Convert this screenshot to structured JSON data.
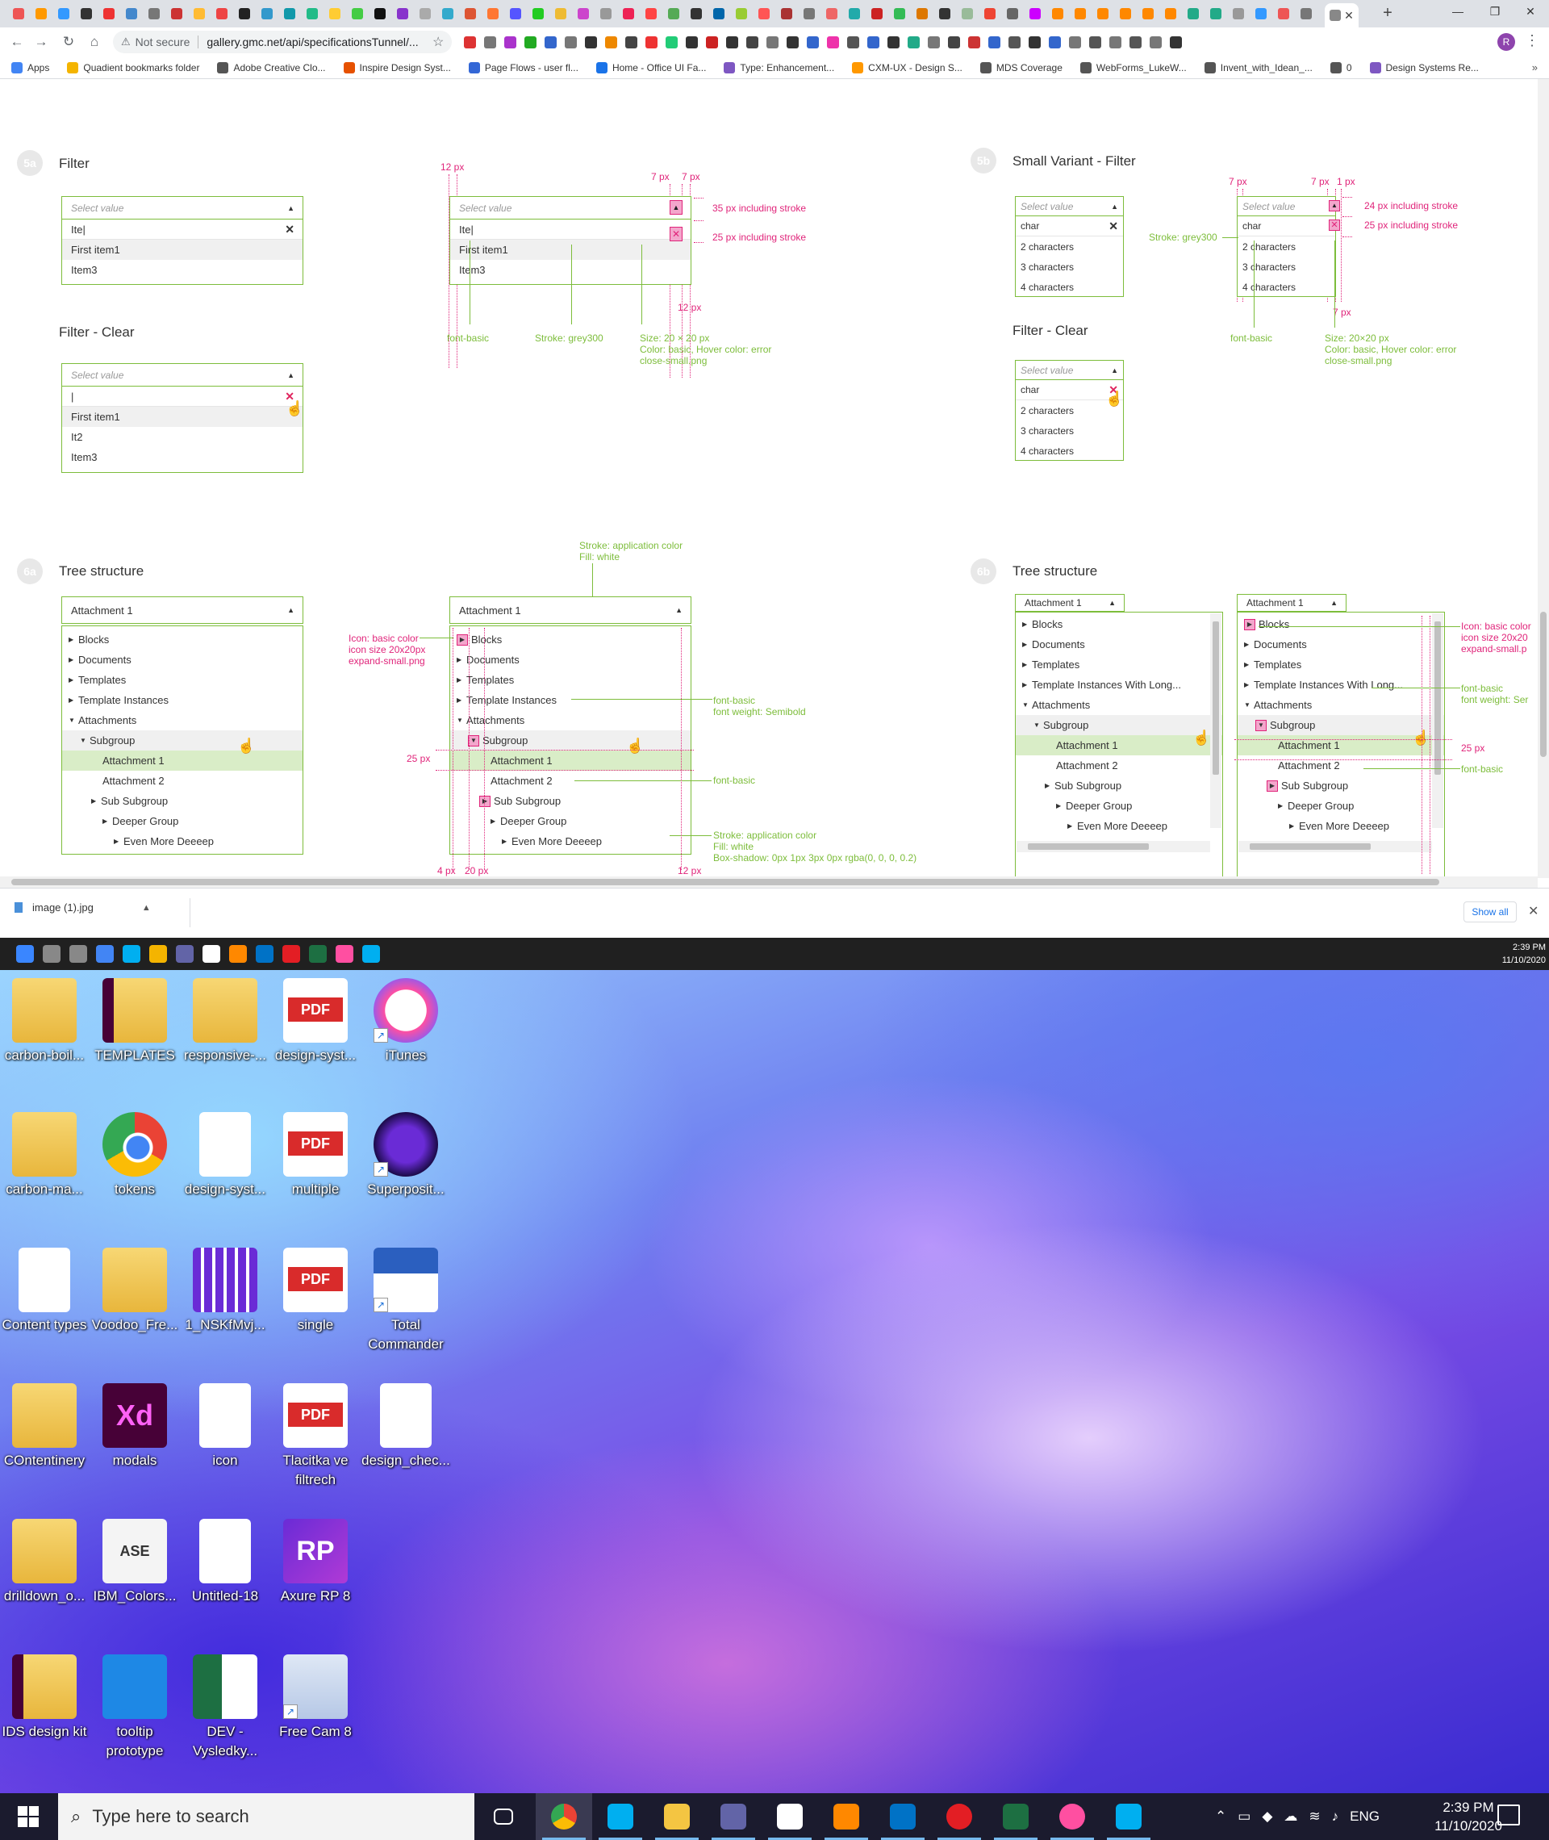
{
  "browser": {
    "url": "gallery.gmc.net/api/specificationsTunnel/...",
    "not_secure": "Not secure",
    "new_tab": "+",
    "tab_close": "✕",
    "win_min": "—",
    "win_max": "❐",
    "win_close": "✕",
    "profile_initial": "R",
    "bookmarks": [
      "Apps",
      "Quadient bookmarks folder",
      "Adobe Creative Clo...",
      "Inspire Design Syst...",
      "Page Flows - user fl...",
      "Home - Office UI Fa...",
      "Type: Enhancement...",
      "CXM-UX - Design S...",
      "MDS Coverage",
      "WebForms_LukeW...",
      "Invent_with_Idean_...",
      "0",
      "Design Systems Re..."
    ],
    "bookmarks_more": "»"
  },
  "sections": {
    "s5a": {
      "num": "5a",
      "title": "Filter"
    },
    "s5a_clear": {
      "title": "Filter - Clear"
    },
    "s5b": {
      "num": "5b",
      "title": "Small Variant - Filter"
    },
    "s5b_clear": {
      "title": "Filter - Clear"
    },
    "s6a": {
      "num": "6a",
      "title": "Tree structure"
    },
    "s6b": {
      "num": "6b",
      "title": "Tree structure"
    }
  },
  "filter": {
    "placeholder": "Select value",
    "input_value": "Ite|",
    "items": [
      "First item1",
      "Item3"
    ],
    "clear_input": "|",
    "clear_items": [
      "First item1",
      "It2",
      "Item3"
    ],
    "spec_input": "Ite|",
    "spec_items": [
      "First item1",
      "Item3"
    ]
  },
  "small_filter": {
    "placeholder": "Select value",
    "input_value": "char",
    "items": [
      "2 characters",
      "3 characters",
      "4 characters"
    ]
  },
  "annotations": {
    "px12_top": "12 px",
    "px7_a": "7 px",
    "px7_b": "7 px",
    "h35": "35 px including stroke",
    "h25": "25 px including stroke",
    "px12_bottom": "12 px",
    "font_basic": "font-basic",
    "stroke_grey": "Stroke: grey300",
    "size_20": "Size: 20 × 20 px",
    "color_basic": "Color: basic, Hover color: error",
    "close_png": "close-small.png",
    "s_px7_a": "7 px",
    "s_px7_b": "7 px",
    "s_px1": "1 px",
    "h24": "24 px including stroke",
    "s_h25": "25 px including stroke",
    "s_stroke_grey": "Stroke: grey300",
    "s_px7_bottom": "7 px",
    "s_font_basic": "font-basic",
    "s_size_20": "Size: 20×20 px",
    "s_color_basic": "Color: basic, Hover color: error",
    "s_close_png": "close-small.png",
    "tree_stroke_top": "Stroke: application color",
    "tree_fill_top": "Fill: white",
    "icon_basic": "Icon: basic color",
    "icon_size": "icon size 20x20px",
    "expand_png": "expand-small.png",
    "tree_font_basic": "font-basic",
    "font_semibold": "font weight: Semibold",
    "px25": "25 px",
    "tree_font_basic2": "font-basic",
    "tree_stroke_bottom": "Stroke: application color",
    "tree_fill_bottom": "Fill: white",
    "box_shadow": "Box-shadow: 0px 1px 3px 0px rgba(0, 0, 0, 0.2)",
    "px4": "4 px",
    "px20": "20 px",
    "px12_tree": "12 px",
    "b_icon_basic": "Icon: basic color",
    "b_icon_size": "icon size 20x20",
    "b_expand_png": "expand-small.p",
    "b_font_basic": "font-basic",
    "b_font_semibold": "font weight: Ser",
    "b_px25": "25 px",
    "b_font_basic2": "font-basic"
  },
  "tree": {
    "header": "Attachment 1",
    "rows": [
      "Blocks",
      "Documents",
      "Templates",
      "Template Instances",
      "Attachments",
      "Subgroup",
      "Attachment 1",
      "Attachment 2",
      "Sub Subgroup",
      "Deeper Group",
      "Even More Deeeep"
    ],
    "small_rows": [
      "Blocks",
      "Documents",
      "Templates",
      "Template Instances With Long...",
      "Attachments",
      "Subgroup",
      "Attachment 1",
      "Attachment 2",
      "Sub Subgroup",
      "Deeper Group",
      "Even More Deeeep"
    ]
  },
  "download": {
    "file": "image (1).jpg",
    "show_all": "Show all",
    "close": "✕"
  },
  "winbar": {
    "time": "2:39 PM",
    "date": "11/10/2020"
  },
  "desktop_icons": [
    [
      "carbon-boil...",
      "TEMPLATES",
      "responsive-...",
      "design-syst...",
      "iTunes"
    ],
    [
      "carbon-ma...",
      "tokens",
      "design-syst...",
      "multiple",
      "Superposit..."
    ],
    [
      "Content types",
      "Voodoo_Fre...",
      "1_NSKfMvj...",
      "single",
      "Total Commander"
    ],
    [
      "COntentinery",
      "modals",
      "icon",
      "Tlacitka ve filtrech",
      "design_chec..."
    ],
    [
      "drilldown_o...",
      "IBM_Colors...",
      "Untitled-18",
      "Axure RP 8"
    ],
    [
      "IDS design kit",
      "tooltip prototype",
      "DEV - Vysledky...",
      "Free Cam 8"
    ]
  ],
  "icon_labels": {
    "pdf": "PDF",
    "xd": "Xd",
    "ase": "ASE",
    "rp": "RP",
    "shortcut": "↗"
  },
  "taskbar": {
    "search_placeholder": "Type here to search",
    "lang": "ENG",
    "time": "2:39 PM",
    "date": "11/10/2020"
  },
  "colors": {
    "application_green": "#7dbd3b",
    "annotation_pink": "#e0247a",
    "selected_bg": "#d9edc7",
    "hover_bg": "#f0f0f0"
  }
}
